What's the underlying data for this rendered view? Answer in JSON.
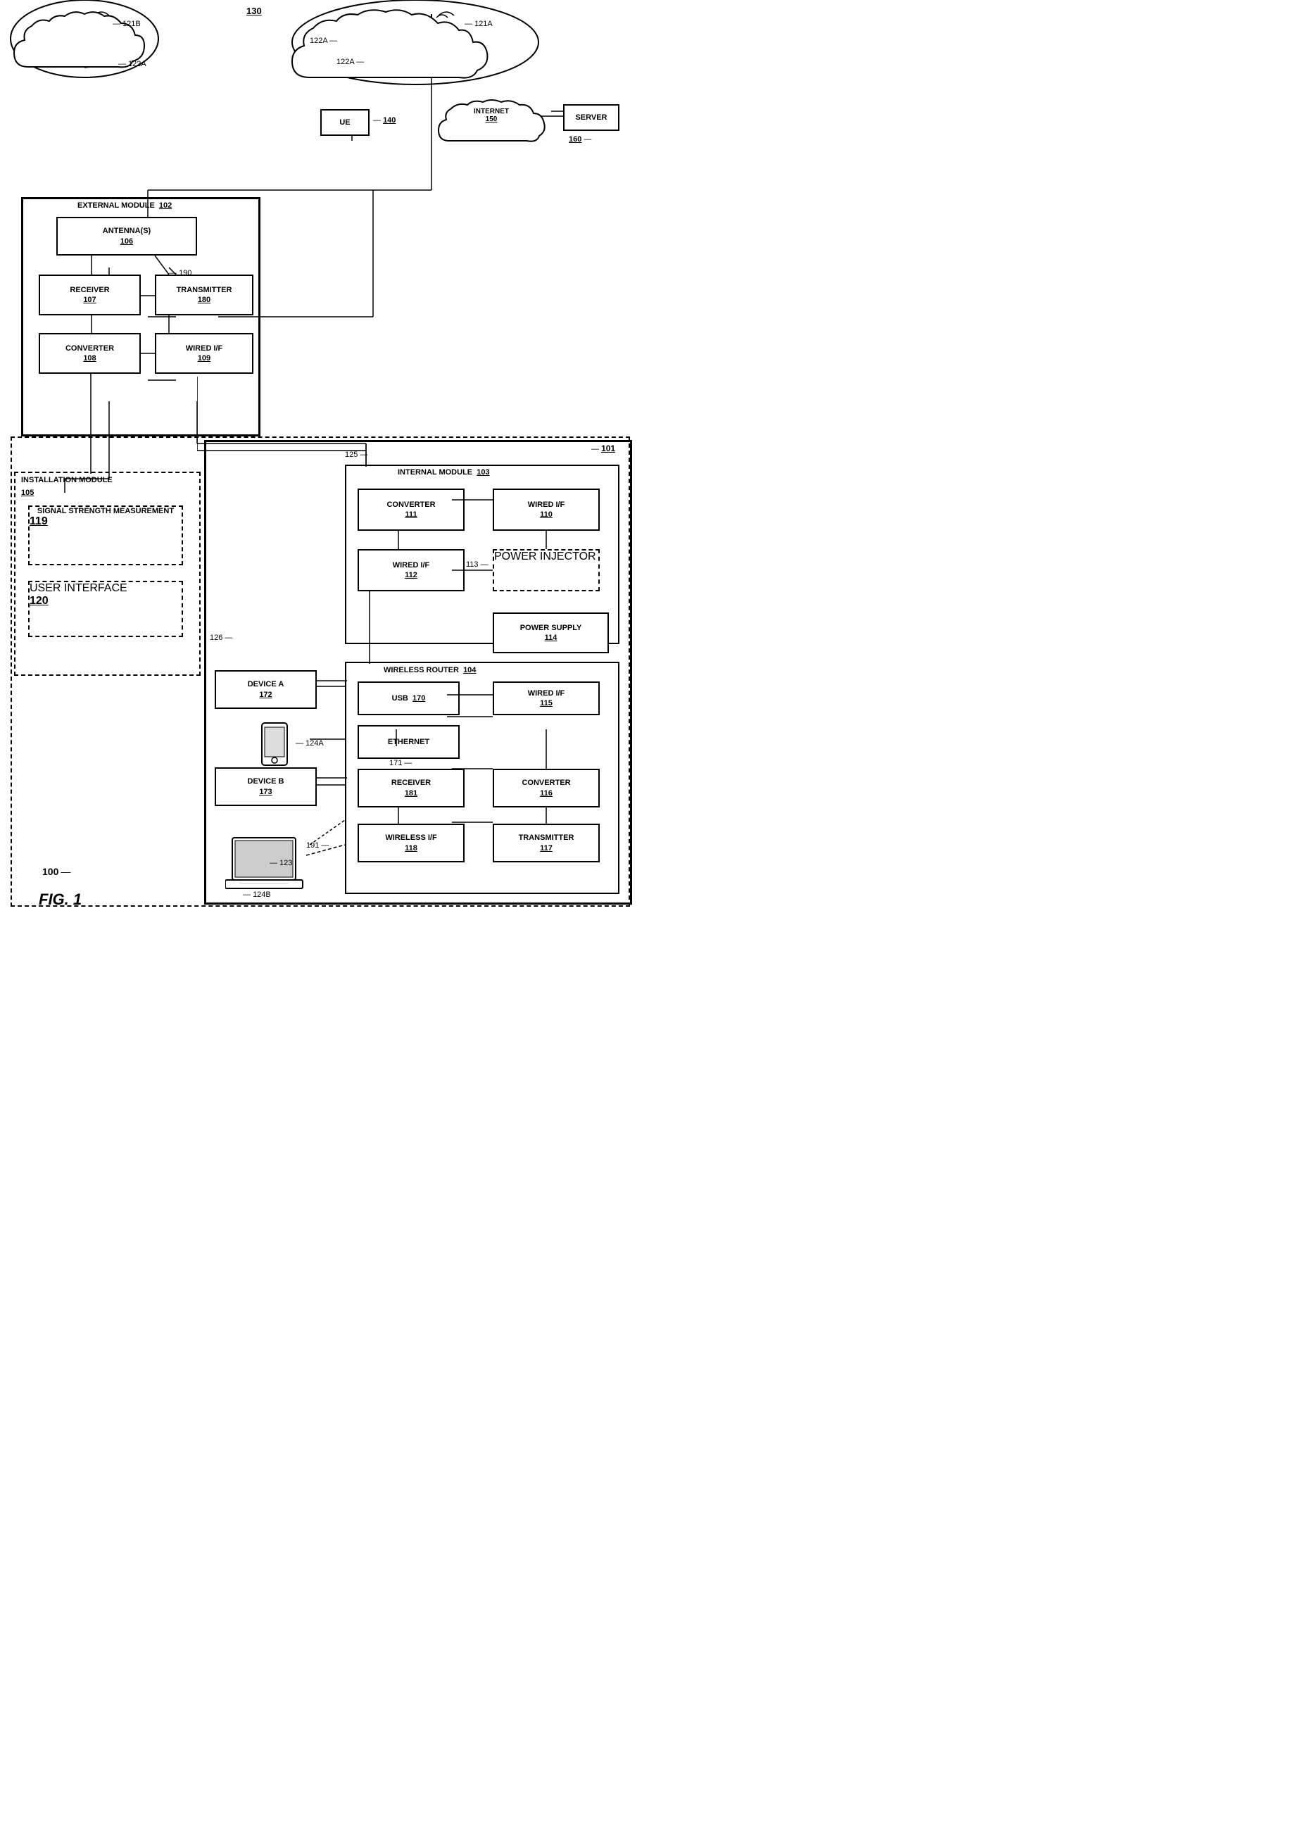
{
  "title": "FIG. 1",
  "modules": {
    "external": {
      "label": "EXTERNAL MODULE",
      "ref": "102"
    },
    "internal": {
      "label": "INTERNAL MODULE",
      "ref": "103"
    },
    "installation": {
      "label": "INSTALLATION MODULE",
      "ref": "105"
    },
    "wireless_router": {
      "label": "WIRELESS ROUTER",
      "ref": "104"
    },
    "home": {
      "ref": "101"
    },
    "system": {
      "ref": "100"
    }
  },
  "boxes": {
    "antennas": {
      "label": "ANTENNA(S)",
      "ref": "106"
    },
    "receiver107": {
      "label": "RECEIVER",
      "ref": "107"
    },
    "transmitter180": {
      "label": "TRANSMITTER",
      "ref": "180"
    },
    "converter108": {
      "label": "CONVERTER",
      "ref": "108"
    },
    "wired_if109": {
      "label": "WIRED I/F",
      "ref": "109"
    },
    "converter111": {
      "label": "CONVERTER",
      "ref": "111"
    },
    "wired_if110": {
      "label": "WIRED I/F",
      "ref": "110"
    },
    "wired_if112": {
      "label": "WIRED I/F",
      "ref": "112"
    },
    "power_injector": {
      "label": "POWER INJECTOR",
      "ref": ""
    },
    "power_supply114": {
      "label": "POWER SUPPLY",
      "ref": "114"
    },
    "signal_strength": {
      "label": "SIGNAL STRENGTH MEASUREMENT",
      "ref": "119"
    },
    "user_interface": {
      "label": "USER INTERFACE",
      "ref": "120"
    },
    "device_a": {
      "label": "DEVICE A",
      "ref": "172"
    },
    "device_b": {
      "label": "DEVICE B",
      "ref": "173"
    },
    "usb170": {
      "label": "USB",
      "ref": "170"
    },
    "ethernet": {
      "label": "ETHERNET",
      "ref": ""
    },
    "wired_if115": {
      "label": "WIRED I/F",
      "ref": "115"
    },
    "receiver181": {
      "label": "RECEIVER",
      "ref": "181"
    },
    "converter116": {
      "label": "CONVERTER",
      "ref": "116"
    },
    "wireless_if118": {
      "label": "WIRELESS I/F",
      "ref": "118"
    },
    "transmitter117": {
      "label": "TRANSMITTER",
      "ref": "117"
    },
    "ue": {
      "label": "UE",
      "ref": "140"
    },
    "internet": {
      "label": "INTERNET",
      "ref": "150"
    },
    "server": {
      "label": "SERVER",
      "ref": "160"
    }
  },
  "ref_labels": {
    "r101": "101",
    "r100": "100",
    "r113": "113",
    "r125": "125",
    "r126": "126",
    "r171": "171",
    "r191": "191",
    "r190": "190",
    "r121a": "121A",
    "r121b": "121B",
    "r122a_1": "122A",
    "r122a_2": "122A",
    "r122a_3": "122A",
    "r124a": "124A",
    "r124b": "124B",
    "r123": "123",
    "r130": "130"
  }
}
